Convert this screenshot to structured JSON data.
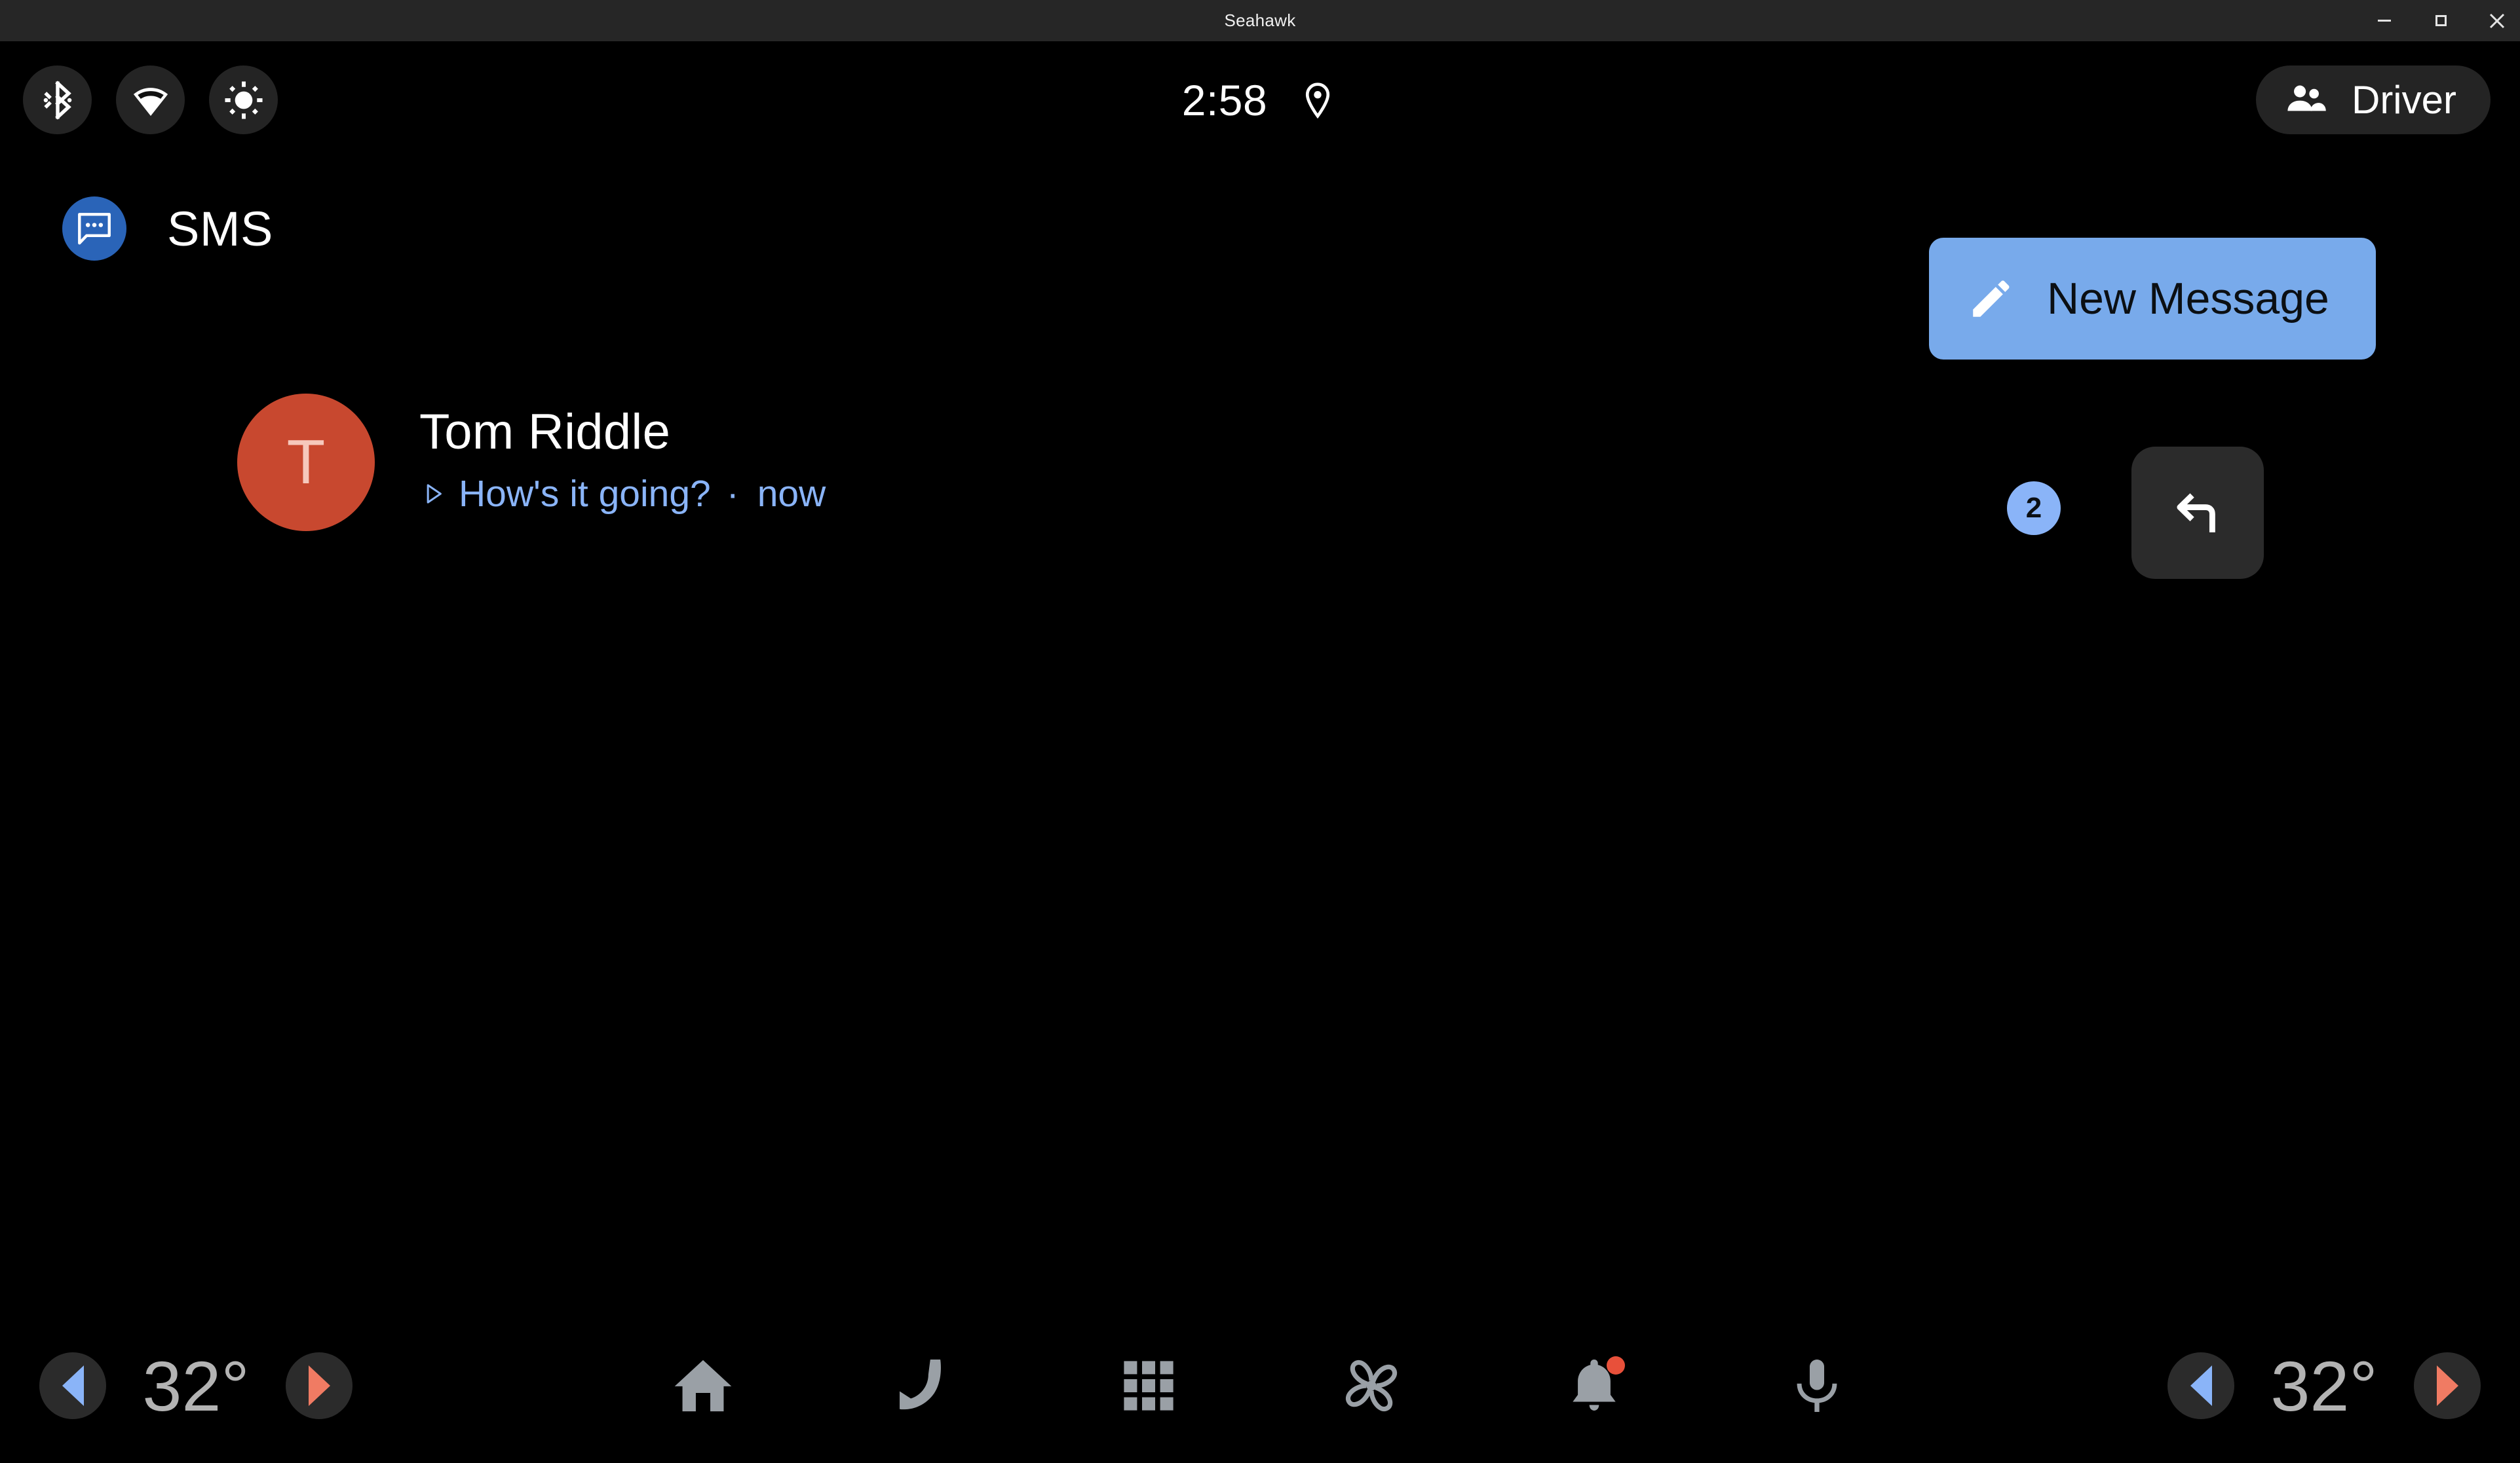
{
  "window": {
    "title": "Seahawk",
    "controls": {
      "minimize": "minimize",
      "maximize": "maximize",
      "close": "close"
    }
  },
  "status_bar": {
    "quick_toggles": [
      {
        "name": "bluetooth",
        "icon": "bluetooth-icon"
      },
      {
        "name": "wifi",
        "icon": "wifi-icon"
      },
      {
        "name": "brightness",
        "icon": "brightness-icon"
      }
    ],
    "clock": "2:58",
    "location_icon": "location-pin-icon",
    "user": {
      "label": "Driver",
      "icon": "people-icon"
    }
  },
  "app_bar": {
    "app_icon": "sms-chat-bubble-icon",
    "app_title": "SMS",
    "new_message": {
      "label": "New Message",
      "icon": "pencil-icon",
      "color": "#78AAEB"
    }
  },
  "conversations": [
    {
      "avatar_initial": "T",
      "avatar_color": "#C8482F",
      "name": "Tom Riddle",
      "preview_icon": "play-triangle-icon",
      "preview_text": "How's it going?",
      "separator": "·",
      "timestamp": "now",
      "preview_color": "#8AB4F8",
      "unread_count": "2",
      "reply_icon": "reply-arrow-icon"
    }
  ],
  "nav_bar": {
    "climate_left": {
      "decrease_icon": "arrow-left-icon",
      "temperature": "32°",
      "increase_icon": "arrow-right-icon"
    },
    "climate_right": {
      "decrease_icon": "arrow-left-icon",
      "temperature": "32°",
      "increase_icon": "arrow-right-icon"
    },
    "items": [
      {
        "name": "home",
        "icon": "home-icon",
        "badge": false
      },
      {
        "name": "phone",
        "icon": "phone-icon",
        "badge": false
      },
      {
        "name": "apps",
        "icon": "app-grid-icon",
        "badge": false
      },
      {
        "name": "climate",
        "icon": "fan-icon",
        "badge": false
      },
      {
        "name": "notifications",
        "icon": "bell-icon",
        "badge": true
      },
      {
        "name": "assistant",
        "icon": "microphone-icon",
        "badge": false
      }
    ]
  },
  "colors": {
    "background": "#000000",
    "titlebar": "#262626",
    "surface": "#242424",
    "accent_blue": "#8AB4F8",
    "button_blue": "#78AAEB",
    "avatar_red": "#C8482F",
    "notification_red": "#E8503A",
    "nav_icon_gray": "#9AA0A6"
  }
}
